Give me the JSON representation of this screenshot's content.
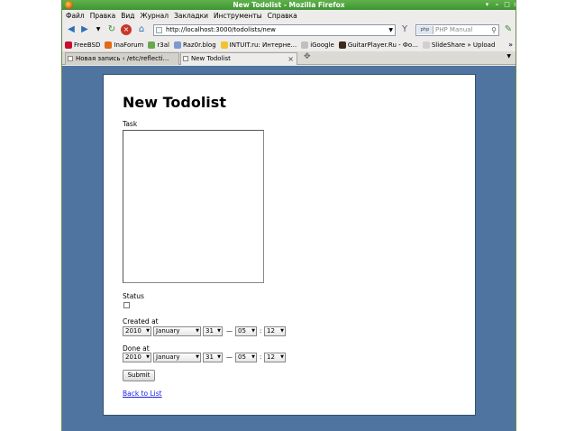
{
  "window": {
    "title": "New Todolist - Mozilla Firefox"
  },
  "menu": [
    "Файл",
    "Правка",
    "Вид",
    "Журнал",
    "Закладки",
    "Инструменты",
    "Справка"
  ],
  "navbar": {
    "url": "http://localhost:3000/todolists/new",
    "search_placeholder": "PHP Manual",
    "search_engine": "php"
  },
  "bookmarks": [
    {
      "label": "FreeBSD",
      "icon": "freebsd-icon",
      "color": "#c8102e"
    },
    {
      "label": "InaForum",
      "icon": "forum-icon",
      "color": "#e06a1a"
    },
    {
      "label": "r3al",
      "icon": "r3al-icon",
      "color": "#6aa84f"
    },
    {
      "label": "Raz0r.blog",
      "icon": "blog-icon",
      "color": "#7a9ad0"
    },
    {
      "label": "INTUIT.ru: Интерне...",
      "icon": "intuit-icon",
      "color": "#f1c232"
    },
    {
      "label": "iGoogle",
      "icon": "igoogle-icon",
      "color": "#c0c0c0"
    },
    {
      "label": "GuitarPlayer.Ru - Фо...",
      "icon": "guitar-icon",
      "color": "#3c2a1a"
    },
    {
      "label": "SlideShare » Upload",
      "icon": "slideshare-icon",
      "color": "#d0d0d0"
    }
  ],
  "tabs": [
    {
      "label": "Новая запись ‹ /etc/reflecti..."
    },
    {
      "label": "New Todolist"
    }
  ],
  "form": {
    "heading": "New Todolist",
    "task_label": "Task",
    "status_label": "Status",
    "created_label": "Created at",
    "done_label": "Done at",
    "created": {
      "year": "2010",
      "month": "January",
      "day": "31",
      "hour": "05",
      "minute": "12"
    },
    "done": {
      "year": "2010",
      "month": "January",
      "day": "31",
      "hour": "05",
      "minute": "12"
    },
    "dash": "—",
    "colon": ":",
    "submit_label": "Submit",
    "back_link": "Back to List"
  },
  "colors": {
    "titlebar": "#4aa23d",
    "content_bg": "#4f74a0",
    "link": "#1a1aee"
  }
}
